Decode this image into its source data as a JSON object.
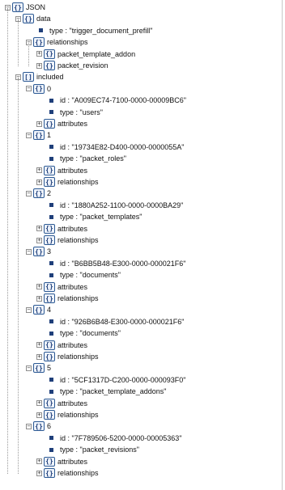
{
  "tree": {
    "root": {
      "label": "JSON"
    },
    "data": {
      "label": "data",
      "type_leaf": "type : \"trigger_document_prefill\"",
      "relationships": {
        "label": "relationships",
        "children": [
          "packet_template_addon",
          "packet_revision"
        ]
      }
    },
    "included": {
      "label": "included",
      "items": [
        {
          "index": "0",
          "id": "id : \"A009EC74-7100-0000-00009BC6\"",
          "type": "type : \"users\"",
          "nodes": [
            "attributes"
          ]
        },
        {
          "index": "1",
          "id": "id : \"19734E82-D400-0000-0000055A\"",
          "type": "type : \"packet_roles\"",
          "nodes": [
            "attributes",
            "relationships"
          ]
        },
        {
          "index": "2",
          "id": "id : \"1880A252-1100-0000-0000BA29\"",
          "type": "type : \"packet_templates\"",
          "nodes": [
            "attributes",
            "relationships"
          ]
        },
        {
          "index": "3",
          "id": "id : \"B6BB5B48-E300-0000-000021F6\"",
          "type": "type : \"documents\"",
          "nodes": [
            "attributes",
            "relationships"
          ]
        },
        {
          "index": "4",
          "id": "id : \"926B6B48-E300-0000-000021F6\"",
          "type": "type : \"documents\"",
          "nodes": [
            "attributes",
            "relationships"
          ]
        },
        {
          "index": "5",
          "id": "id : \"5CF1317D-C200-0000-000093F0\"",
          "type": "type : \"packet_template_addons\"",
          "nodes": [
            "attributes",
            "relationships"
          ]
        },
        {
          "index": "6",
          "id": "id : \"7F789506-5200-0000-00005363\"",
          "type": "type : \"packet_revisions\"",
          "nodes": [
            "attributes",
            "relationships"
          ]
        }
      ]
    }
  },
  "icons": {
    "object": "{}",
    "array": "[]",
    "expanded": "−",
    "collapsed": "+"
  }
}
